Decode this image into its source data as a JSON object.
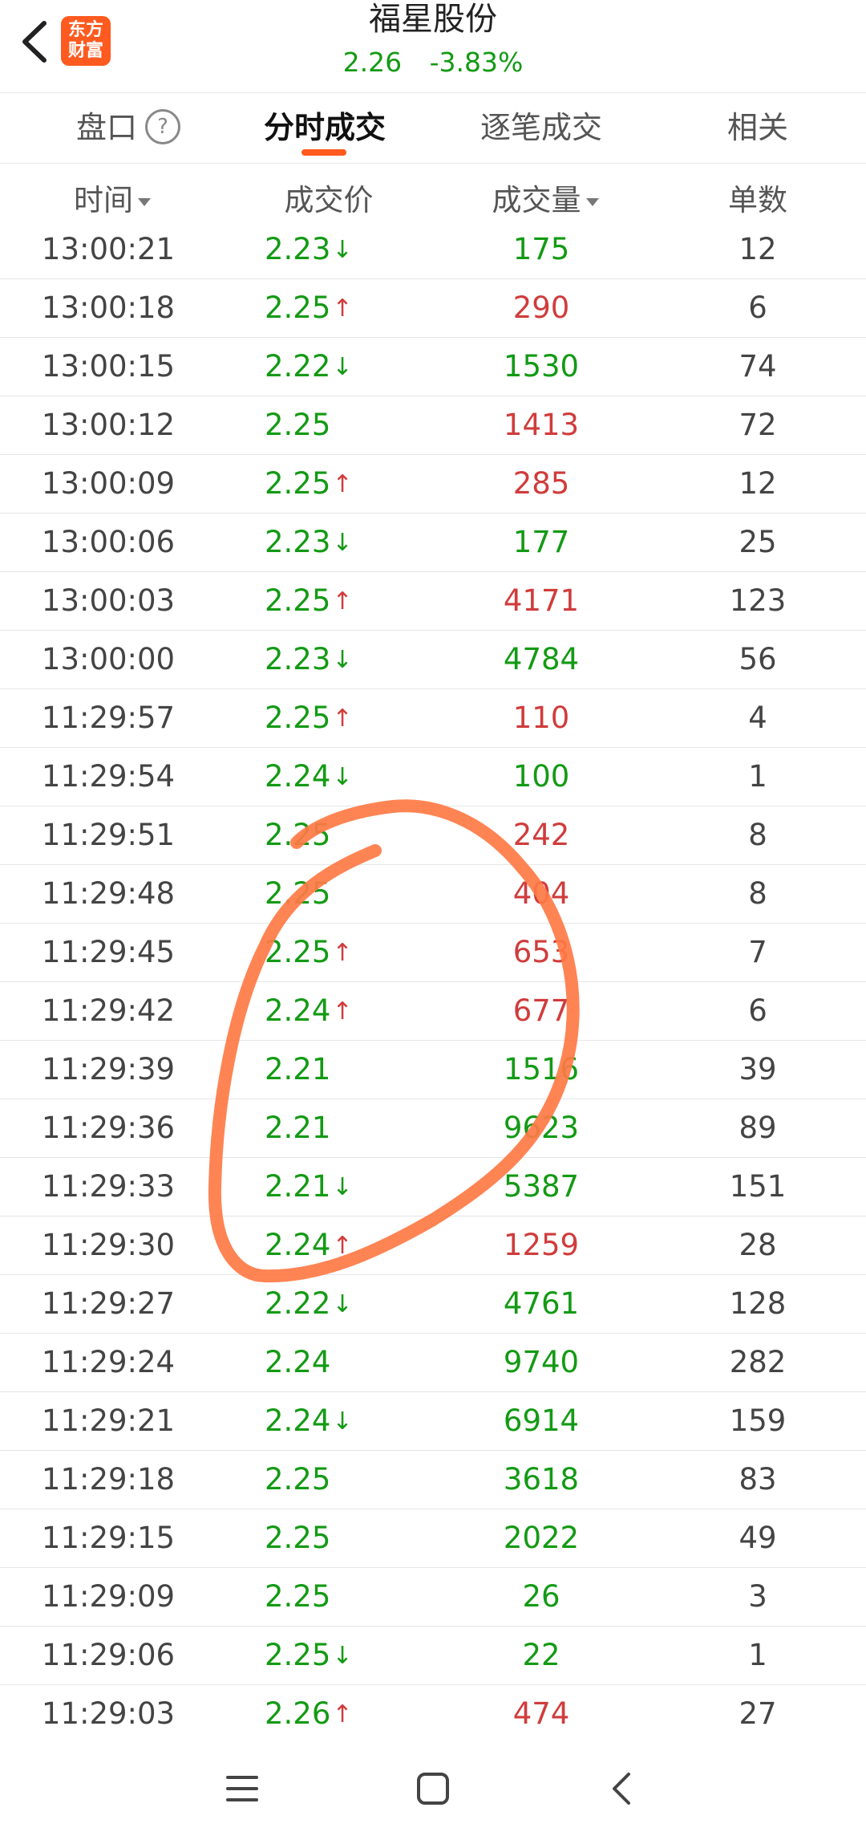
{
  "header": {
    "title": "福星股份",
    "price": "2.26",
    "change_pct": "-3.83%",
    "logo_text_line1": "东方",
    "logo_text_line2": "财富",
    "accent_color": "#ff5a1f",
    "icons": {
      "back": "chevron-left-icon"
    }
  },
  "tabs": [
    {
      "label": "盘口",
      "active": false
    },
    {
      "label": "分时成交",
      "active": true
    },
    {
      "label": "逐笔成交",
      "active": false
    },
    {
      "label": "相关",
      "active": false
    }
  ],
  "columns": {
    "time": "时间",
    "price": "成交价",
    "volume": "成交量",
    "count": "单数"
  },
  "colors": {
    "up": "#d03c3c",
    "down": "#139a14",
    "annotation": "#ff7a45"
  },
  "rows": [
    {
      "time": "13:00:21",
      "price": "2.23",
      "arrow": "↓",
      "volume": "175",
      "count": "12",
      "vol_color": "green"
    },
    {
      "time": "13:00:18",
      "price": "2.25",
      "arrow": "↑",
      "volume": "290",
      "count": "6",
      "vol_color": "red"
    },
    {
      "time": "13:00:15",
      "price": "2.22",
      "arrow": "↓",
      "volume": "1530",
      "count": "74",
      "vol_color": "green"
    },
    {
      "time": "13:00:12",
      "price": "2.25",
      "arrow": "",
      "volume": "1413",
      "count": "72",
      "vol_color": "red"
    },
    {
      "time": "13:00:09",
      "price": "2.25",
      "arrow": "↑",
      "volume": "285",
      "count": "12",
      "vol_color": "red"
    },
    {
      "time": "13:00:06",
      "price": "2.23",
      "arrow": "↓",
      "volume": "177",
      "count": "25",
      "vol_color": "green"
    },
    {
      "time": "13:00:03",
      "price": "2.25",
      "arrow": "↑",
      "volume": "4171",
      "count": "123",
      "vol_color": "red"
    },
    {
      "time": "13:00:00",
      "price": "2.23",
      "arrow": "↓",
      "volume": "4784",
      "count": "56",
      "vol_color": "green"
    },
    {
      "time": "11:29:57",
      "price": "2.25",
      "arrow": "↑",
      "volume": "110",
      "count": "4",
      "vol_color": "red"
    },
    {
      "time": "11:29:54",
      "price": "2.24",
      "arrow": "↓",
      "volume": "100",
      "count": "1",
      "vol_color": "green"
    },
    {
      "time": "11:29:51",
      "price": "2.25",
      "arrow": "",
      "volume": "242",
      "count": "8",
      "vol_color": "red"
    },
    {
      "time": "11:29:48",
      "price": "2.25",
      "arrow": "",
      "volume": "404",
      "count": "8",
      "vol_color": "red"
    },
    {
      "time": "11:29:45",
      "price": "2.25",
      "arrow": "↑",
      "volume": "653",
      "count": "7",
      "vol_color": "red"
    },
    {
      "time": "11:29:42",
      "price": "2.24",
      "arrow": "↑",
      "volume": "677",
      "count": "6",
      "vol_color": "red"
    },
    {
      "time": "11:29:39",
      "price": "2.21",
      "arrow": "",
      "volume": "1516",
      "count": "39",
      "vol_color": "green"
    },
    {
      "time": "11:29:36",
      "price": "2.21",
      "arrow": "",
      "volume": "9623",
      "count": "89",
      "vol_color": "green"
    },
    {
      "time": "11:29:33",
      "price": "2.21",
      "arrow": "↓",
      "volume": "5387",
      "count": "151",
      "vol_color": "green"
    },
    {
      "time": "11:29:30",
      "price": "2.24",
      "arrow": "↑",
      "volume": "1259",
      "count": "28",
      "vol_color": "red"
    },
    {
      "time": "11:29:27",
      "price": "2.22",
      "arrow": "↓",
      "volume": "4761",
      "count": "128",
      "vol_color": "green"
    },
    {
      "time": "11:29:24",
      "price": "2.24",
      "arrow": "",
      "volume": "9740",
      "count": "282",
      "vol_color": "green"
    },
    {
      "time": "11:29:21",
      "price": "2.24",
      "arrow": "↓",
      "volume": "6914",
      "count": "159",
      "vol_color": "green"
    },
    {
      "time": "11:29:18",
      "price": "2.25",
      "arrow": "",
      "volume": "3618",
      "count": "83",
      "vol_color": "green"
    },
    {
      "time": "11:29:15",
      "price": "2.25",
      "arrow": "",
      "volume": "2022",
      "count": "49",
      "vol_color": "green"
    },
    {
      "time": "11:29:09",
      "price": "2.25",
      "arrow": "",
      "volume": "26",
      "count": "3",
      "vol_color": "green"
    },
    {
      "time": "11:29:06",
      "price": "2.25",
      "arrow": "↓",
      "volume": "22",
      "count": "1",
      "vol_color": "green"
    },
    {
      "time": "11:29:03",
      "price": "2.26",
      "arrow": "↑",
      "volume": "474",
      "count": "27",
      "vol_color": "red"
    }
  ],
  "navbar": {
    "icons": [
      "menu-icon",
      "home-square-icon",
      "back-triangle-icon"
    ]
  }
}
